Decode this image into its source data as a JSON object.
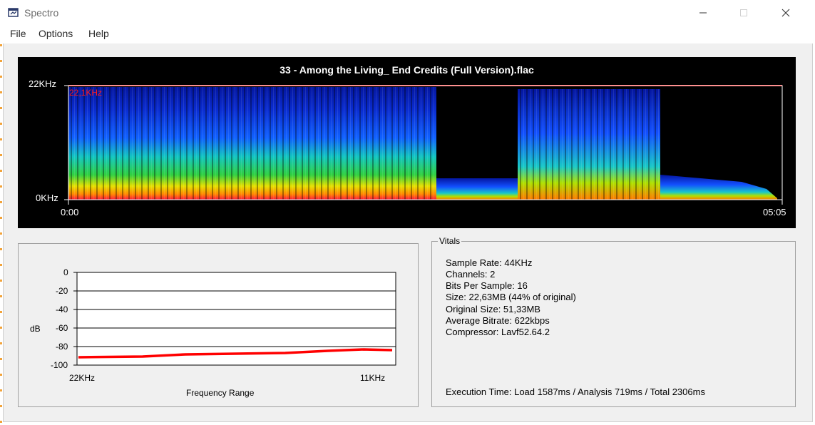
{
  "window": {
    "title": "Spectro"
  },
  "menu": [
    "File",
    "Options",
    "Help"
  ],
  "spectrogram": {
    "file_title": "33 - Among the Living_ End Credits (Full Version).flac",
    "freq_top_label": "22KHz",
    "freq_bottom_label": "0KHz",
    "cutoff_label": "22,1KHz",
    "time_start": "0:00",
    "time_end": "05:05"
  },
  "graph": {
    "y_ticks": [
      "0",
      "-20",
      "-40",
      "-60",
      "-80",
      "-100"
    ],
    "y_label": "dB",
    "x_left": "22KHz",
    "x_right": "11KHz",
    "x_label": "Frequency Range"
  },
  "vitals": {
    "legend": "Vitals",
    "sample_rate": "Sample Rate: 44KHz",
    "channels": "Channels: 2",
    "bits": "Bits Per Sample: 16",
    "size": "Size: 22,63MB (44% of original)",
    "original_size": "Original Size: 51,33MB",
    "avg_bitrate": "Average Bitrate: 622kbps",
    "compressor": "Compressor: Lavf52.64.2",
    "execution": "Execution Time: Load 1587ms / Analysis 719ms / Total 2306ms"
  },
  "colors": {
    "spectrum_line": "#ff0000",
    "cutoff": "#ff2020",
    "panel_bg": "#000000"
  }
}
